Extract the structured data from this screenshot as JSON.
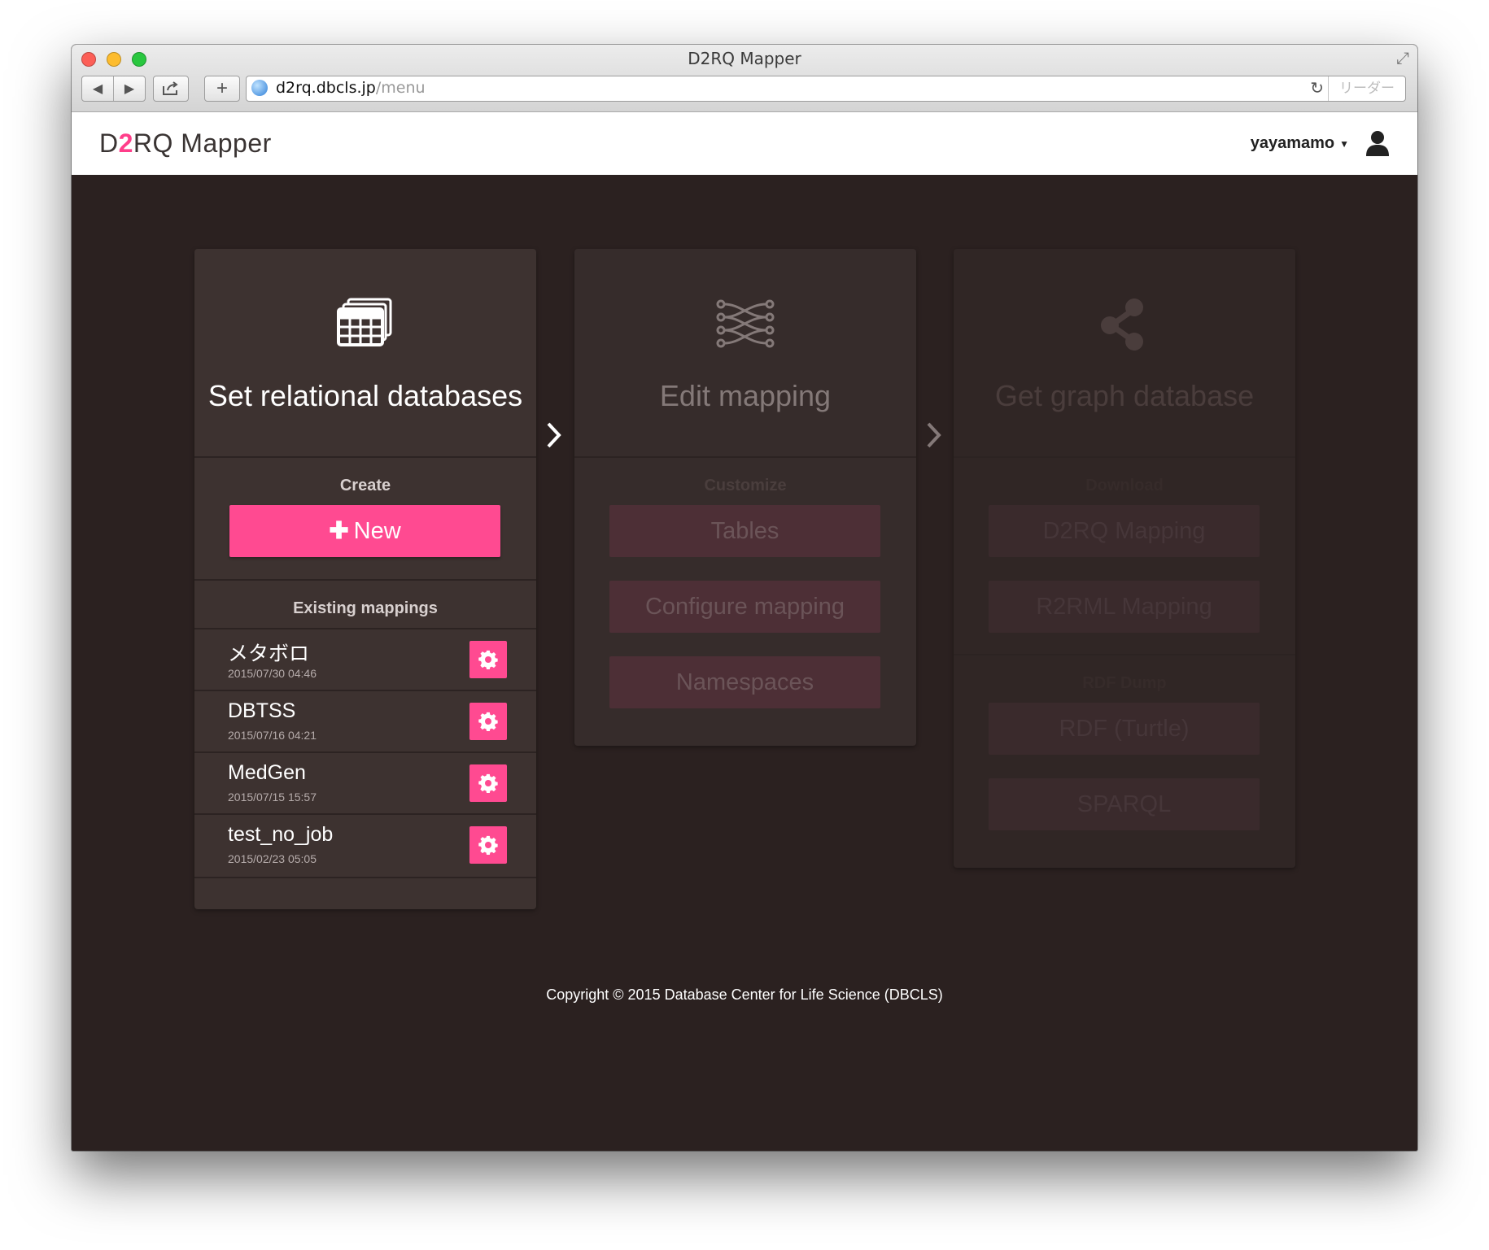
{
  "browser": {
    "window_title": "D2RQ Mapper",
    "url_host": "d2rq.dbcls.jp",
    "url_path": "/menu",
    "reader_label": "リーダー"
  },
  "header": {
    "logo_prefix": "D",
    "logo_accent": "2",
    "logo_suffix": "RQ Mapper",
    "username": "yayamamo"
  },
  "steps": [
    {
      "title": "Set relational databases",
      "icon": "database-table-icon",
      "create_label": "Create",
      "new_button": "New",
      "existing_label": "Existing mappings",
      "mappings": [
        {
          "name": "メタボロ",
          "date": "2015/07/30 04:46"
        },
        {
          "name": "DBTSS",
          "date": "2015/07/16 04:21"
        },
        {
          "name": "MedGen",
          "date": "2015/07/15 15:57"
        },
        {
          "name": "test_no_job",
          "date": "2015/02/23 05:05"
        }
      ]
    },
    {
      "title": "Edit mapping",
      "icon": "mapping-lines-icon",
      "section_label": "Customize",
      "buttons": [
        "Tables",
        "Configure mapping",
        "Namespaces"
      ]
    },
    {
      "title": "Get graph database",
      "icon": "share-graph-icon",
      "section1_label": "Download",
      "buttons1": [
        "D2RQ Mapping",
        "R2RML Mapping"
      ],
      "section2_label": "RDF Dump",
      "buttons2": [
        "RDF (Turtle)",
        "SPARQL"
      ]
    }
  ],
  "footer": "Copyright © 2015 Database Center for Life Science (DBCLS)",
  "colors": {
    "accent": "#ff4a91",
    "background": "#2b2120",
    "card": "#3d3230"
  }
}
